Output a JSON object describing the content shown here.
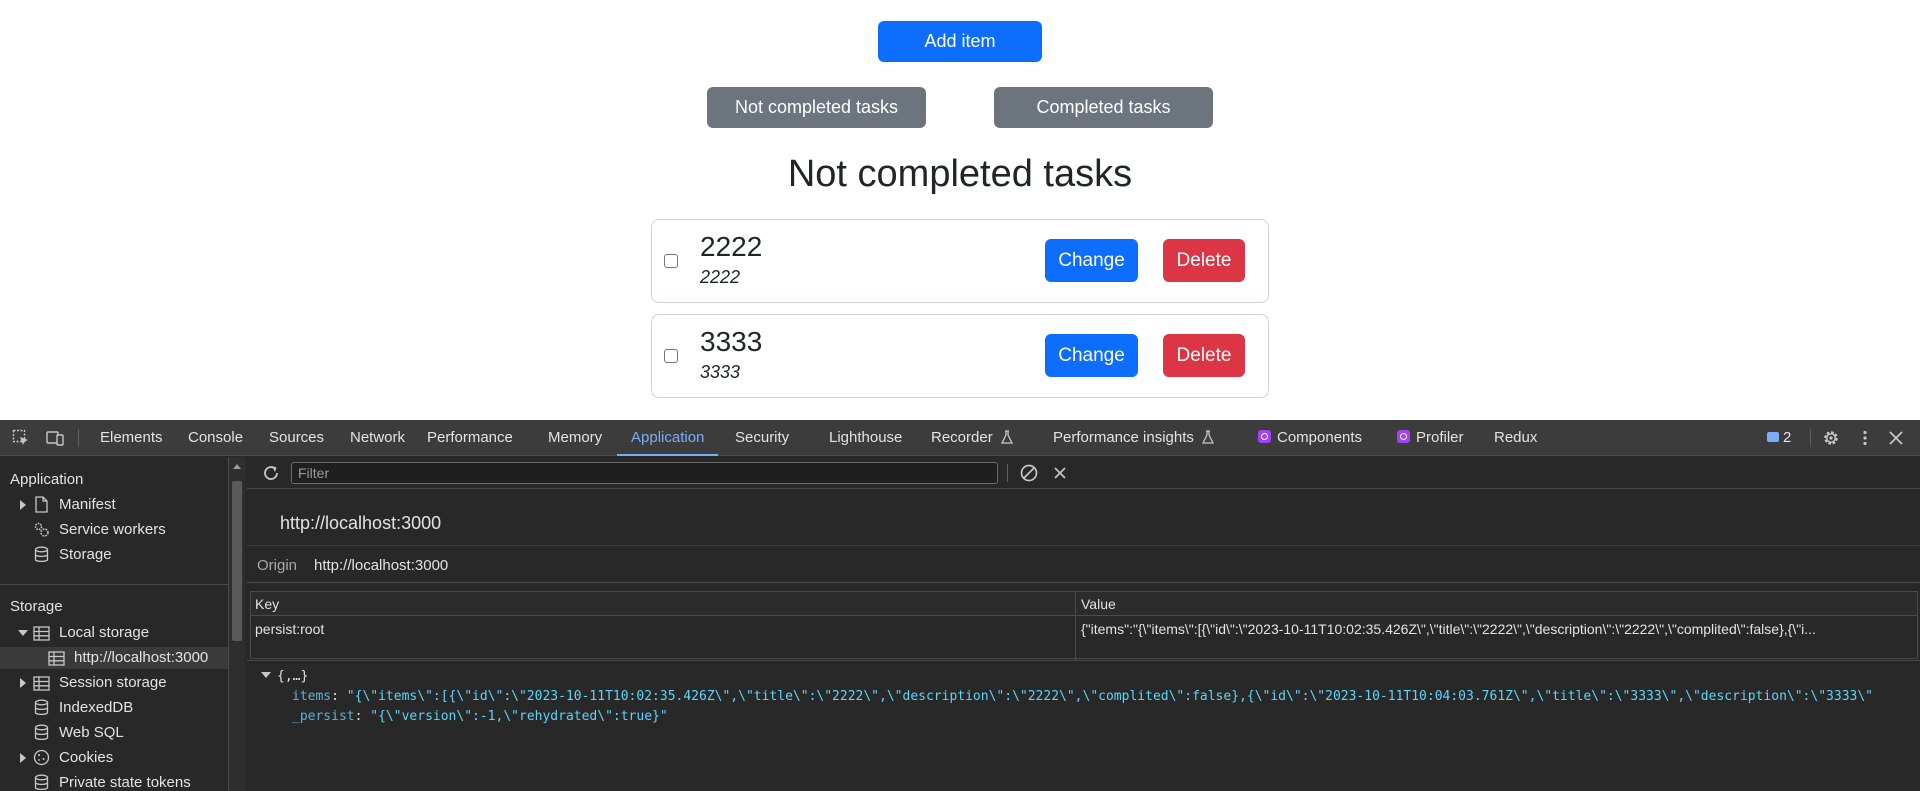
{
  "app": {
    "add_button": "Add item",
    "filters": {
      "not_completed": "Not completed tasks",
      "completed": "Completed tasks"
    },
    "list_title": "Not completed tasks",
    "tasks": [
      {
        "title": "2222",
        "description": "2222",
        "change_label": "Change",
        "delete_label": "Delete",
        "checked": false
      },
      {
        "title": "3333",
        "description": "3333",
        "change_label": "Change",
        "delete_label": "Delete",
        "checked": false
      }
    ]
  },
  "devtools": {
    "tabs": [
      "Elements",
      "Console",
      "Sources",
      "Network",
      "Performance",
      "Memory",
      "Application",
      "Security",
      "Lighthouse",
      "Recorder",
      "Performance insights",
      "Components",
      "Profiler",
      "Redux"
    ],
    "active_tab": "Application",
    "issues_count": "2",
    "sidebar": {
      "application_header": "Application",
      "application_items": [
        "Manifest",
        "Service workers",
        "Storage"
      ],
      "storage_header": "Storage",
      "storage_items": [
        "Local storage",
        "http://localhost:3000",
        "Session storage",
        "IndexedDB",
        "Web SQL",
        "Cookies",
        "Private state tokens"
      ]
    },
    "filter_placeholder": "Filter",
    "origin_title": "http://localhost:3000",
    "origin_label": "Origin",
    "origin_value": "http://localhost:3000",
    "table": {
      "key_header": "Key",
      "value_header": "Value",
      "row_key": "persist:root",
      "row_value": "{\"items\":\"{\\\"items\\\":[{\\\"id\\\":\\\"2023-10-11T10:02:35.426Z\\\",\\\"title\\\":\\\"2222\\\",\\\"description\\\":\\\"2222\\\",\\\"complited\\\":false},{\\\"i..."
    },
    "preview": {
      "root": "{,…}",
      "items_key": "items",
      "items_value": "\"{\\\"items\\\":[{\\\"id\\\":\\\"2023-10-11T10:02:35.426Z\\\",\\\"title\\\":\\\"2222\\\",\\\"description\\\":\\\"2222\\\",\\\"complited\\\":false},{\\\"id\\\":\\\"2023-10-11T10:04:03.761Z\\\",\\\"title\\\":\\\"3333\\\",\\\"description\\\":\\\"3333\\\"",
      "persist_key": "_persist",
      "persist_value": "\"{\\\"version\\\":-1,\\\"rehydrated\\\":true}\""
    },
    "colors": {
      "accent": "#7cacf8",
      "primary": "#0d6efd",
      "secondary": "#6c757d",
      "danger": "#dc3545"
    }
  }
}
